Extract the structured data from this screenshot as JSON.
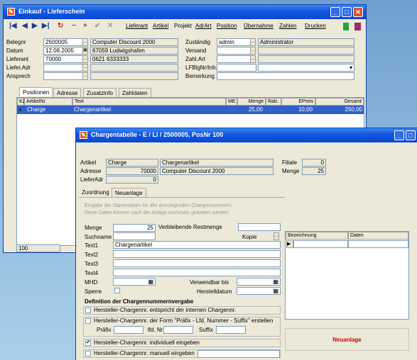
{
  "main_window": {
    "title": "Einkauf - Lieferschein",
    "menu": [
      "Lieferant",
      "Artikel",
      "Projekt",
      "AdrArt",
      "Position",
      "Übernahme",
      "Zahlen",
      "Drucken"
    ],
    "fields": {
      "belegnr_label": "Belegnr",
      "belegnr_value": "2500005",
      "datum_label": "Datum",
      "datum_value": "12.08.2005",
      "lieferant_label": "Lieferant",
      "lieferant_value": "70000",
      "liefer_adr_label": "Liefer.Adr",
      "ansprech_label": "Ansprech",
      "company_name": "Computer Discount 2000",
      "company_city": "67059  Ludwigshafen",
      "company_phone": "0621 6333333",
      "zustaendig_label": "Zuständig",
      "zustaendig_value": "admin",
      "zustaendig_name": "Administrator",
      "versand_label": "Versand",
      "zahl_art_label": "Zahl.Art",
      "lf_blg_label": "LFBlgNr/Inh.",
      "bemerkung_label": "Bemerkung"
    },
    "tabs": [
      "Positionen",
      "Adresse",
      "Zusatzinfo",
      "Zahldaten"
    ],
    "grid_headers": [
      "KZ",
      "ArtikelNr",
      "Text",
      "ME",
      "Menge",
      "Rab.",
      "EPreis",
      "Gesamt"
    ],
    "grid_row": {
      "kz": "",
      "artikelnr": "Charge",
      "text": "Chargenartikel",
      "me": "",
      "menge": "25,00",
      "rab": "",
      "epreis": "10,00",
      "gesamt": "250,00"
    },
    "bottom_value": "100"
  },
  "charge_window": {
    "title": "Chargentabelle - E / LI / 2500005, PosNr 100",
    "artikel_label": "Artikel",
    "artikel_value": "Charge",
    "artikel_name": "Chargenartikel",
    "adresse_label": "Adresse",
    "adresse_value": "70000",
    "adresse_name": "Computer Discount 2000",
    "lieferadr_label": "LieferAdr",
    "lieferadr_value": "0",
    "filiale_label": "Filiale",
    "filiale_value": "0",
    "menge_label": "Menge",
    "menge_value": "25",
    "zuordnung_tab": "Zuordnung",
    "neuanlage_tab": "Neuanlage",
    "hint_line1": "Eingabe der Stammdaten für alle anzulegenden Chargennummern.",
    "hint_line2": "Diese Daten können nach der Anlage nochmals geändert werden.",
    "menge2_label": "Menge",
    "menge2_value": "25",
    "restmenge_label": "Verbleibende Restmenge",
    "suchname_label": "Suchname",
    "kopie_label": "Kopie",
    "text1_label": "Text1",
    "text1_value": "Chargenartikel",
    "text2_label": "Text2",
    "text3_label": "Text3",
    "text4_label": "Text4",
    "mhd_label": "MHD",
    "verwendbar_label": "Verwendbar bis",
    "sperre_label": "Sperre",
    "herstelldatum_label": "Herstelldatum",
    "definition_label": "Definition der Chargennummernvergabe",
    "option1": "Hersteller-Chargennr. entspricht der internen Chargennr.",
    "option2": "Hersteller-Chargennr. der Form \"Präfix - Lfd. Nummer - Suffix\" erstellen",
    "praefix_label": "Präfix",
    "lfdnr_label": "lfd. Nr",
    "suffix_label": "Suffix",
    "option3": "Hersteller-Chargennr. individuell eingeben",
    "option4": "Hersteller-Chargennr. manuell eingeben",
    "grid_col1": "Bezeichnung",
    "grid_col2": "Daten",
    "neuanlage_button": "Neuanlage"
  },
  "colors": {
    "title_blue": "#0a48d2",
    "selection": "#3160c8",
    "accent_red": "#cc0000"
  }
}
